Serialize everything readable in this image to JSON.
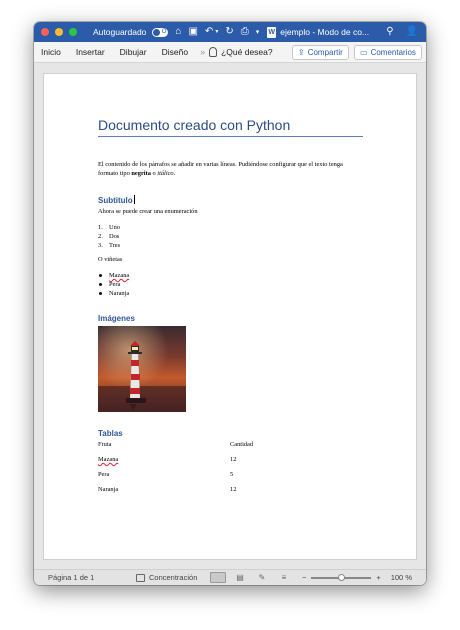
{
  "titlebar": {
    "autosave_label": "Autoguardado",
    "autosave_state": "O",
    "doc_title": "ejemplo  -  Modo de co..."
  },
  "ribbon": {
    "tabs": [
      "Inicio",
      "Insertar",
      "Dibujar",
      "Diseño"
    ],
    "more": "»",
    "tell_me": "¿Qué desea?",
    "share_label": "Compartir",
    "comments_label": "Comentarios"
  },
  "document": {
    "title": "Documento creado con Python",
    "paragraph_before": "El contenido de los párrafos se añadir en varias líneas. Pudiéndose configurar que el texto tenga formato tipo ",
    "paragraph_bold": "negrita",
    "paragraph_mid": " o ",
    "paragraph_italic": "itálico",
    "paragraph_end": ".",
    "subtitle": "Subtitulo",
    "enum_intro": "Ahora se puede crear una enumeración",
    "numbered": [
      {
        "num": "1.",
        "text": "Uno"
      },
      {
        "num": "2.",
        "text": "Dos"
      },
      {
        "num": "3.",
        "text": "Tres"
      }
    ],
    "bullets_intro": "O viñetas",
    "bullets": [
      "Mazana",
      "Pera",
      "Naranja"
    ],
    "images_heading": "Imágenes",
    "tables_heading": "Tablas",
    "table": {
      "headers": [
        "Fruta",
        "Cantidad"
      ],
      "rows": [
        [
          "Mazana",
          "12"
        ],
        [
          "Pera",
          "5"
        ],
        [
          "Naranja",
          "12"
        ]
      ]
    }
  },
  "statusbar": {
    "page": "Página 1 de 1",
    "focus": "Concentración",
    "zoom_out": "−",
    "zoom_in": "+",
    "zoom": "100 %",
    "zoom_fraction": 0.5
  },
  "colors": {
    "titlebar": "#2c5ba9",
    "heading": "#2b4c82",
    "subheading": "#2f5897"
  }
}
